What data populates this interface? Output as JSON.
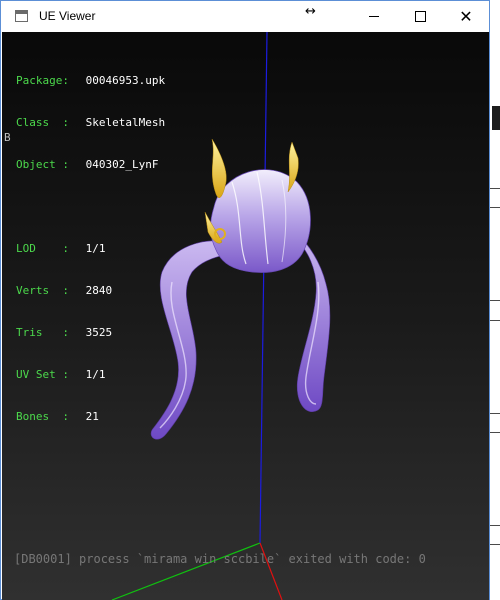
{
  "window": {
    "title": "UE Viewer",
    "icons": {
      "app": "app-window-icon",
      "resize": "resize-horizontal-icon",
      "minimize": "minimize-icon",
      "maximize": "maximize-icon",
      "close": "close-icon"
    },
    "resize_glyph": "↔",
    "close_glyph": "✕"
  },
  "viewer": {
    "package_label": "Package:",
    "package_value": "00046953.upk",
    "class_label": "Class  :",
    "class_value": "SkeletalMesh",
    "object_label": "Object :",
    "object_value": "040302_LynF",
    "lod_label": "LOD    :",
    "lod_value": "1/1",
    "verts_label": "Verts  :",
    "verts_value": "2840",
    "tris_label": "Tris   :",
    "tris_value": "3525",
    "uvset_label": "UV Set :",
    "uvset_value": "1/1",
    "bones_label": "Bones  :",
    "bones_value": "21",
    "label_color": "#4cd94c",
    "value_color": "#ffffff",
    "axis_colors": {
      "x": "#ff0000",
      "y": "#00c000",
      "z": "#0000ff"
    }
  },
  "background": {
    "console_text": "[DB0001] process `mirama win sccbile` exited with code: 0",
    "stray_char": "B"
  }
}
